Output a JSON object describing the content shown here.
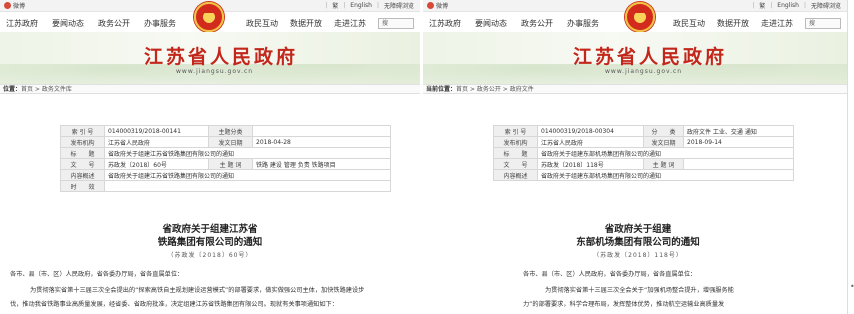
{
  "left": {
    "topbar": {
      "weibo": "微博",
      "lang_sep": "繁",
      "english": "English",
      "accessibility": "无障碍浏览"
    },
    "nav": {
      "items": [
        "江苏政府",
        "要闻动态",
        "政务公开",
        "办事服务"
      ],
      "right_items": [
        "政民互动",
        "数据开放",
        "走进江苏"
      ],
      "search_placeholder": "搜"
    },
    "banner": {
      "title": "江苏省人民政府",
      "url": "www.jiangsu.gov.cn"
    },
    "breadcrumb": {
      "label": "位置：",
      "path": "首页 > 政务文件库"
    },
    "meta": {
      "rows": [
        [
          "索 引 号",
          "014000319/2018-00141",
          "主题分类",
          ""
        ],
        [
          "发布机构",
          "江苏省人民政府",
          "发文日期",
          "2018-04-28"
        ],
        [
          "标　　题",
          "省政府关于组建江苏省铁路集团有限公司的通知",
          "",
          ""
        ],
        [
          "文　　号",
          "苏政发〔2018〕60号",
          "主 题 词",
          "铁路 建设 管理 负责 铁路项目"
        ],
        [
          "内容概述",
          "省政府关于组建江苏省铁路集团有限公司的通知",
          "",
          ""
        ],
        [
          "时　　效",
          "",
          "",
          ""
        ]
      ]
    },
    "doc": {
      "title_line1": "省政府关于组建江苏省",
      "title_line2": "铁路集团有限公司的通知",
      "doc_no": "（苏政发〔2018〕60号）",
      "salutation": "各市、县（市、区）人民政府，省各委办厅局，省各直属单位：",
      "p1": "为贯彻落实省第十三届三次全会提出的“探索高铁自主规划建设运营模式”的部署要求，做实做强公司主体，加快铁路建设步",
      "p2": "伐，推动我省铁路事业高质量发展，经省委、省政府批准，决定组建江苏省铁路集团有限公司。现就有关事项通知如下："
    }
  },
  "right": {
    "topbar": {
      "weibo": "微博",
      "lang_sep": "繁",
      "english": "English",
      "accessibility": "无障碍浏览"
    },
    "nav": {
      "items": [
        "江苏政府",
        "要闻动态",
        "政务公开",
        "办事服务"
      ],
      "right_items": [
        "政民互动",
        "数据开放",
        "走进江苏"
      ],
      "search_placeholder": "搜"
    },
    "banner": {
      "title": "江苏省人民政府",
      "url": "www.jiangsu.gov.cn"
    },
    "breadcrumb": {
      "label": "当前位置：",
      "path": "首页 > 政务公开 > 政府文件"
    },
    "meta": {
      "rows": [
        [
          "索 引 号",
          "014000319/2018-00304",
          "分　　类",
          "政府文件 工业、交通 通知"
        ],
        [
          "发布机构",
          "江苏省人民政府",
          "发文日期",
          "2018-09-14"
        ],
        [
          "标　　题",
          "省政府关于组建东部机场集团有限公司的通知",
          "",
          ""
        ],
        [
          "文　　号",
          "苏政发〔2018〕118号",
          "主 题 词",
          ""
        ],
        [
          "内容概述",
          "省政府关于组建东部机场集团有限公司的通知",
          "",
          ""
        ]
      ]
    },
    "doc": {
      "title_line1": "省政府关于组建",
      "title_line2": "东部机场集团有限公司的通知",
      "doc_no": "（苏政发〔2018〕118号）",
      "salutation": "各市、县（市、区）人民政府，省各委办厅局，省各直属单位：",
      "p1": "为贯彻落实省第十三届三次全会关于“加强机场整合提升，增强服务能",
      "p2": "力”的部署要求，科学合理布局，发挥整体优势，推动航空运输业高质量发"
    }
  },
  "colors": {
    "brand_red": "#c3261a",
    "banner_green": "#eef4e7"
  }
}
